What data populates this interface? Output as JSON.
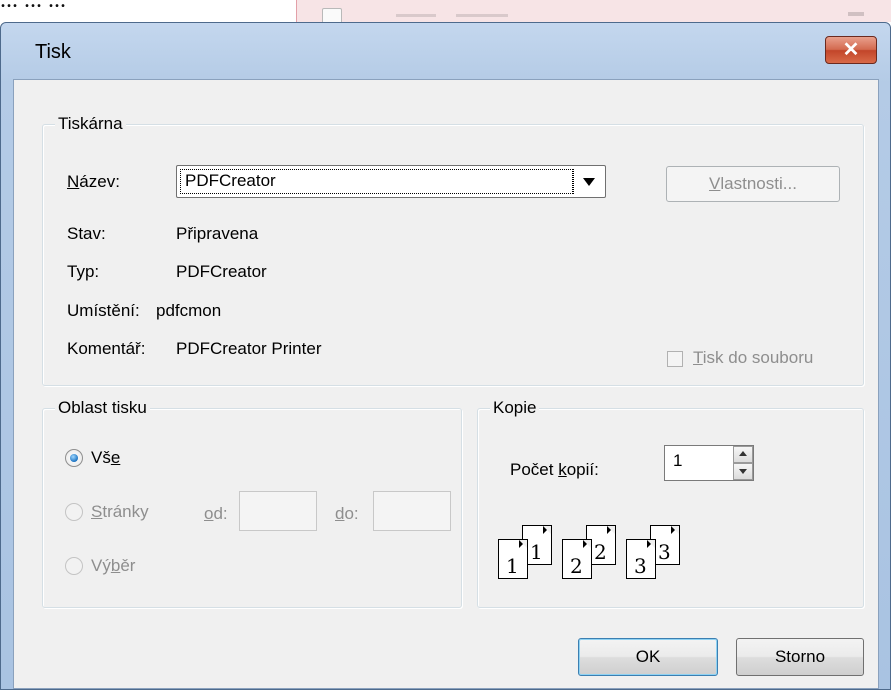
{
  "background": {
    "left_text": "... ... ...",
    "accent_color": "#f7e4e6"
  },
  "dialog": {
    "title": "Tisk",
    "close_icon": "close-icon",
    "close_color": "#c2452a"
  },
  "printer": {
    "legend": "Tiskárna",
    "name_label": "[N]ázev:",
    "name_value": "PDFCreator",
    "properties_button": "[V]lastnosti...",
    "status_label": "Stav:",
    "status_value": "Připravena",
    "type_label": "Typ:",
    "type_value": "PDFCreator",
    "location_label": "Umístění:",
    "location_value": "pdfcmon",
    "comment_label": "Komentář:",
    "comment_value": "PDFCreator Printer",
    "print_to_file_label": "[T]isk do souboru",
    "print_to_file_checked": false
  },
  "print_range": {
    "legend": "Oblast tisku",
    "all_label": "Vš[e]",
    "all_selected": true,
    "pages_label": "[S]tránky",
    "from_label": "[o]d:",
    "from_value": "",
    "to_label": "[d]o:",
    "to_value": "",
    "selection_label": "Vý[b]ěr"
  },
  "copies": {
    "legend": "Kopie",
    "count_label": "Počet [k]opií:",
    "count_value": "1",
    "collate_pages": [
      "1",
      "2",
      "3"
    ]
  },
  "footer": {
    "ok_button": "OK",
    "cancel_button": "Storno"
  }
}
